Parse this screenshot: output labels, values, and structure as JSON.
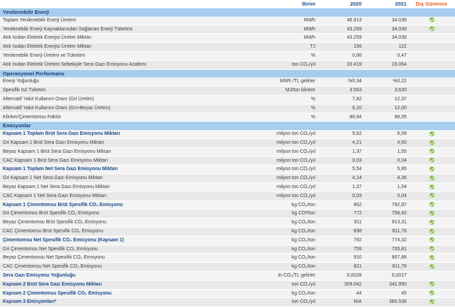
{
  "header": {
    "unit": "Birim",
    "year1": "2020",
    "year2": "2021",
    "assurance": "Dış Güvence"
  },
  "sections": [
    {
      "title": "Yenilenebilir Enerji",
      "rows": [
        {
          "label": "Toplam Yenilenebilir Enerji Üretimi",
          "unit": "MWh",
          "v1": "46.913",
          "v2": "34.039",
          "check": true,
          "bold": false
        },
        {
          "label": "Yenilenebilir Enerji Kaynaklarından Sağlanan Enerji Tüketimi",
          "unit": "MWh",
          "v1": "43.259",
          "v2": "34.039",
          "check": true,
          "bold": false
        },
        {
          "label": "Atık Isıdan Elektrik Enerjisi Üretim Miktarı",
          "unit": "MWh",
          "v1": "43.259",
          "v2": "34.039",
          "check": false,
          "bold": false
        },
        {
          "label": "Atık Isıdan Elektrik Enerjisi Üretim Miktarı",
          "unit": "TJ",
          "v1": "156",
          "v2": "122",
          "check": false,
          "bold": false
        },
        {
          "label": "Yenilenebilir Enerji Üretimi ve Tüketimi",
          "unit": "%",
          "v1": "0,66",
          "v2": "0,47",
          "check": false,
          "bold": false
        },
        {
          "label": "Atık Isıdan Elektrik Üretimi Sebebiyle Sera Gazı Emisyonu Azaltımı",
          "unit": "ton CO₂/yıl",
          "v1": "20.419",
          "v2": "16.054",
          "check": false,
          "bold": false
        }
      ]
    },
    {
      "title": "Operasyonel Performans",
      "rows": [
        {
          "label": "Enerji Yoğunluğu",
          "unit": "MWh /TL gelirler",
          "v1": "%0,34",
          "v2": "%0,22",
          "check": false,
          "bold": false
        },
        {
          "label": "Spesifik Isıl Tüketim",
          "unit": "MJ/ton klinker",
          "v1": "3.563",
          "v2": "3.620",
          "check": false,
          "bold": false
        },
        {
          "label": "Alternatif Yakıt Kullanım Oranı (Gri Üretim)",
          "unit": "%",
          "v1": "7,82",
          "v2": "12,37",
          "check": false,
          "bold": false
        },
        {
          "label": "Alternatif Yakıt Kullanım Oranı (Gri+Beyaz Üretim)",
          "unit": "%",
          "v1": "6,10",
          "v2": "12,00",
          "check": false,
          "bold": false
        },
        {
          "label": "Klinker/Çimentomsu Faktör",
          "unit": "%",
          "v1": "88,84",
          "v2": "88,05",
          "check": false,
          "bold": false
        }
      ]
    },
    {
      "title": "Emisyonlar",
      "rows": [
        {
          "label": "Kapsam 1 Toplam Brüt Sera Gazı Emisyonu Miktarı",
          "unit": "milyon ton CO₂/yıl",
          "v1": "5,62",
          "v2": "6,09",
          "check": true,
          "bold": true
        },
        {
          "label": "Gri Kapsam 1 Brüt Sera Gazı Emisyonu Miktarı",
          "unit": "milyon ton CO₂/yıl",
          "v1": "4,21",
          "v2": "4,50",
          "check": true,
          "bold": false
        },
        {
          "label": "Beyaz Kapsam 1 Brüt Sera Gazı Emisyonu Miktarı",
          "unit": "milyon ton CO₂/yıl",
          "v1": "1,37",
          "v2": "1,55",
          "check": true,
          "bold": false
        },
        {
          "label": "CAC Kapsam 1 Brüt Sera Gazı Emisyonu Miktarı",
          "unit": "milyon ton CO₂/yıl",
          "v1": "0,03",
          "v2": "0,04",
          "check": true,
          "bold": false
        },
        {
          "label": "Kapsam 1 Toplam Net Sera Gazı Emisyonu Miktarı",
          "unit": "milyon ton CO₂/yıl",
          "v1": "5,54",
          "v2": "5,95",
          "check": true,
          "bold": true
        },
        {
          "label": "Gri Kapsam 1 Net Sera Gazı Emisyonu Miktarı",
          "unit": "milyon ton CO₂/yıl",
          "v1": "4,14",
          "v2": "4,36",
          "check": true,
          "bold": false
        },
        {
          "label": "Beyaz Kapsam 1 Net Sera Gazı Emisyonu Miktarı",
          "unit": "milyon ton CO₂/yıl",
          "v1": "1,37",
          "v2": "1,54",
          "check": true,
          "bold": false
        },
        {
          "label": "CAC Kapsam 1 Net Sera Gazı Emisyonu Miktarı",
          "unit": "milyon ton CO₂/yıl",
          "v1": "0,03",
          "v2": "0,04",
          "check": true,
          "bold": false
        },
        {
          "label": "Kapsam 1 Çimentomsu Brüt Spesifik CO₂ Emisyonu",
          "unit": "kg CO₂/ton",
          "v1": "802",
          "v2": "792,97",
          "check": true,
          "bold": true
        },
        {
          "label": "Gri Çimentomsu Brüt Spesifik CO₂ Emisyonu",
          "unit": "kg CO²/ton",
          "v1": "772",
          "v2": "758,42",
          "check": true,
          "bold": false
        },
        {
          "label": "Beyaz Çimentomsu Brüt Spesifik CO₂ Emisyonu",
          "unit": "kg CO₂/ton",
          "v1": "911",
          "v2": "913,31",
          "check": true,
          "bold": false
        },
        {
          "label": "CAC Çimentomsu Brüt Spesifik CO₂ Emisyonu",
          "unit": "kg CO₂/ton",
          "v1": "838",
          "v2": "811,76",
          "check": true,
          "bold": false
        },
        {
          "label": "Çimentomsu Net Spesifik CO₂ Emisyonu (Kapsam 1)",
          "unit": "kg CO₂/ton",
          "v1": "792",
          "v2": "774,32",
          "check": true,
          "bold": true
        },
        {
          "label": "Gri Çimentomsu Net Spesifik CO₂ Emisyonu",
          "unit": "kg CO₂/ton",
          "v1": "759",
          "v2": "735,81",
          "check": true,
          "bold": false
        },
        {
          "label": "Beyaz Çimentomsu Net Spesifik CO₂ Emisyonu",
          "unit": "kg CO₂/ton",
          "v1": "910",
          "v2": "907,88",
          "check": true,
          "bold": false
        },
        {
          "label": "CAC Çimentomsu Net Spesifik CO₂ Emisyonu",
          "unit": "kg CO₂/ton",
          "v1": "821",
          "v2": "811,76",
          "check": true,
          "bold": false
        },
        {
          "label": "Sera Gazı Emisyonu Yoğunluğu",
          "unit": "tn CO₂/TL gelirler",
          "v1": "0,0028",
          "v2": "0,0017",
          "check": false,
          "bold": true
        },
        {
          "label": "Kapsam 2 Brüt Sera Gazı Emisyonu Miktarı",
          "unit": "ton CO₂/yıl",
          "v1": "309.042",
          "v2": "341.950",
          "check": true,
          "bold": true
        },
        {
          "label": "Kapsam 2 Çimentomsu Spesifik CO₂ Emisyonu",
          "unit": "kg CO₂/ton",
          "v1": "44",
          "v2": "45",
          "check": true,
          "bold": true
        },
        {
          "label": "Kapsam 3 Emisyonları*",
          "unit": "ton CO₂/yıl",
          "v1": "N/A",
          "v2": "360.536",
          "check": true,
          "bold": true
        }
      ]
    }
  ],
  "colors": {
    "section_bg": "#a6cdee",
    "header_text": "#1a4a8c",
    "assurance_text": "#e05a1e",
    "check": "#7dbf3f"
  }
}
